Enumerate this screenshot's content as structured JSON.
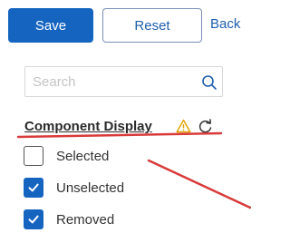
{
  "toolbar": {
    "save_label": "Save",
    "reset_label": "Reset",
    "back_label": "Back"
  },
  "search": {
    "placeholder": "Search",
    "value": ""
  },
  "section": {
    "title": "Component Display",
    "options": [
      {
        "label": "Selected",
        "checked": false
      },
      {
        "label": "Unselected",
        "checked": true
      },
      {
        "label": "Removed",
        "checked": true
      }
    ]
  },
  "colors": {
    "accent": "#1565c0",
    "annotation": "#d93a3a",
    "warning": "#e0a100"
  },
  "icons": [
    "search-icon",
    "warning-icon",
    "refresh-icon",
    "checkmark-icon"
  ]
}
